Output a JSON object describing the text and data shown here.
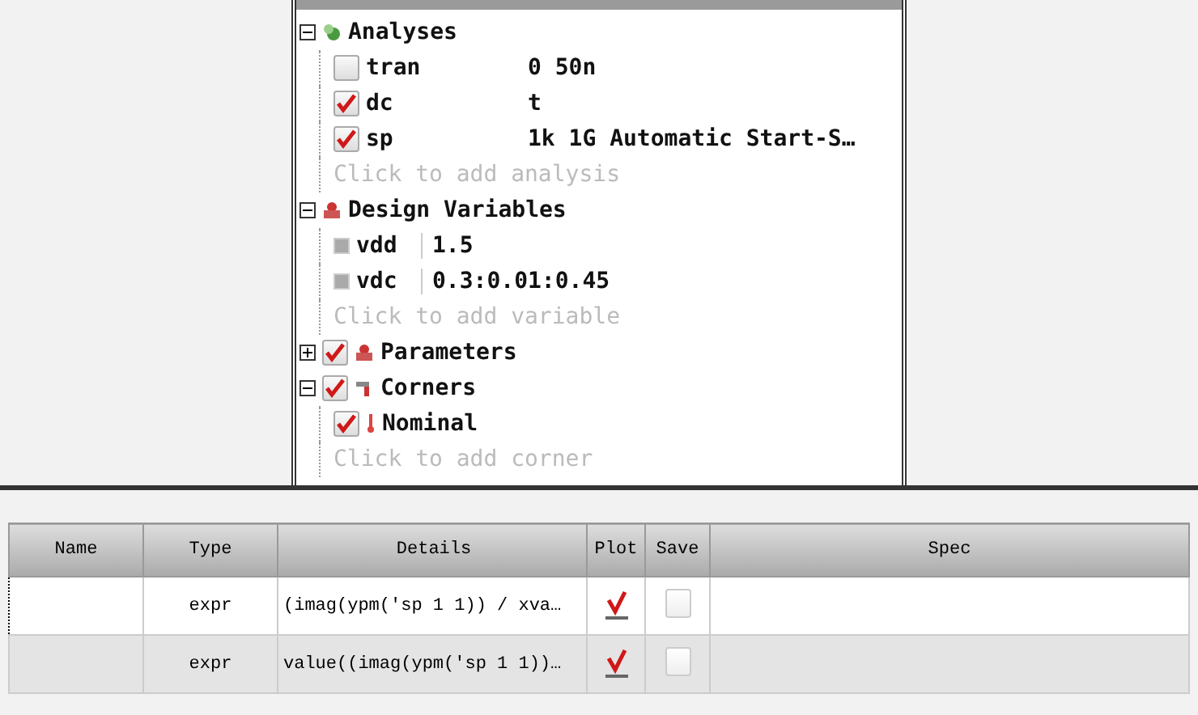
{
  "tree": [
    {
      "kind": "analyses",
      "label": "Analyses",
      "expanded": true,
      "items": [
        {
          "kind": "check",
          "checked": false,
          "name": "tran",
          "value": "0 50n"
        },
        {
          "kind": "check",
          "checked": true,
          "name": "dc",
          "value": "t"
        },
        {
          "kind": "check",
          "checked": true,
          "name": "sp",
          "value": "1k 1G Automatic Start-S…"
        }
      ],
      "hint": "Click to add analysis"
    },
    {
      "kind": "variables",
      "label": "Design Variables",
      "expanded": true,
      "items": [
        {
          "kind": "var",
          "name": "vdd",
          "value": "1.5"
        },
        {
          "kind": "var",
          "name": "vdc",
          "value": "0.3:0.01:0.45"
        }
      ],
      "hint": "Click to add variable"
    },
    {
      "kind": "parameters",
      "label": "Parameters",
      "expanded": false,
      "checked": true
    },
    {
      "kind": "corners",
      "label": "Corners",
      "expanded": true,
      "checked": true,
      "items": [
        {
          "kind": "corner",
          "checked": true,
          "name": "Nominal"
        }
      ],
      "hint": "Click to add corner"
    }
  ],
  "table": {
    "columns": [
      "Name",
      "Type",
      "Details",
      "Plot",
      "Save",
      "Spec"
    ],
    "rows": [
      {
        "selected": true,
        "type": "expr",
        "details": "(imag(ypm('sp 1 1)) / xva…",
        "plot": true,
        "save": false
      },
      {
        "selected": false,
        "type": "expr",
        "details": "value((imag(ypm('sp 1 1))…",
        "plot": true,
        "save": false
      }
    ]
  }
}
